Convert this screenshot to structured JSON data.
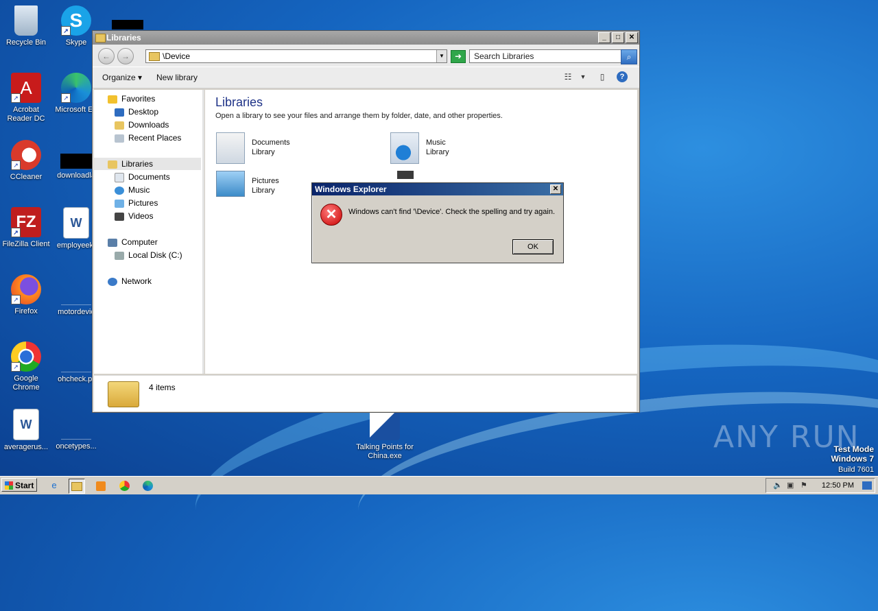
{
  "desktop": {
    "icons": [
      {
        "label": "Recycle Bin"
      },
      {
        "label": "Skype"
      },
      {
        "label": "Acrobat Reader DC"
      },
      {
        "label": "Microsoft Ed"
      },
      {
        "label": "CCleaner"
      },
      {
        "label": "downloadla"
      },
      {
        "label": "FileZilla Client"
      },
      {
        "label": "employeek."
      },
      {
        "label": "Firefox"
      },
      {
        "label": "motordevic"
      },
      {
        "label": "Google Chrome"
      },
      {
        "label": "ohcheck.pr"
      },
      {
        "label": "averagerus..."
      },
      {
        "label": "oncetypes..."
      },
      {
        "label": "Talking Points for China.exe"
      }
    ],
    "watermark": {
      "test_mode": "Test Mode",
      "os": "Windows 7",
      "build": "Build 7601"
    },
    "anyrun": "ANY RUN"
  },
  "explorer": {
    "title": "Libraries",
    "address": "\\Device",
    "search_placeholder": "Search Libraries",
    "toolbar": {
      "organize": "Organize",
      "new_library": "New library"
    },
    "nav": {
      "favorites": "Favorites",
      "desktop": "Desktop",
      "downloads": "Downloads",
      "recent": "Recent Places",
      "libraries": "Libraries",
      "documents": "Documents",
      "music": "Music",
      "pictures": "Pictures",
      "videos": "Videos",
      "computer": "Computer",
      "local_disk": "Local Disk (C:)",
      "network": "Network"
    },
    "content": {
      "heading": "Libraries",
      "subtitle": "Open a library to see your files and arrange them by folder, date, and other properties.",
      "libraries": [
        {
          "name": "Documents",
          "type": "Library"
        },
        {
          "name": "Music",
          "type": "Library"
        },
        {
          "name": "Pictures",
          "type": "Library"
        }
      ]
    },
    "status": "4 items"
  },
  "dialog": {
    "title": "Windows Explorer",
    "message": "Windows can't find '\\Device'.  Check the spelling and try again.",
    "ok": "OK"
  },
  "taskbar": {
    "start": "Start",
    "clock": "12:50 PM"
  }
}
